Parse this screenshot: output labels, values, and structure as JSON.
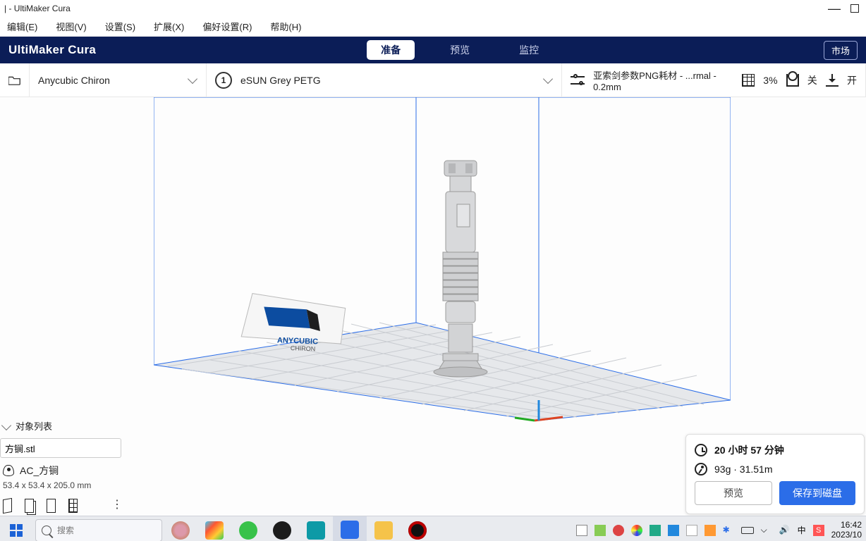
{
  "title": "| - UltiMaker Cura",
  "menu": [
    "编辑(E)",
    "视图(V)",
    "设置(S)",
    "扩展(X)",
    "偏好设置(R)",
    "帮助(H)"
  ],
  "brand": "UltiMaker Cura",
  "tabs": {
    "prepare": "准备",
    "preview": "预览",
    "monitor": "监控"
  },
  "market": "市场",
  "printer": "Anycubic Chiron",
  "extruder_num": "1",
  "material": "eSUN Grey PETG",
  "profile": {
    "name": "亚索剑参数PNG耗材 - ...rmal - 0.2mm",
    "infill": "3%",
    "support": "关",
    "adhesion": "开"
  },
  "object_list": {
    "header": "对象列表",
    "file": "方锏.stl",
    "name": "AC_方锏",
    "dims": "53.4 x 53.4 x 205.0  mm"
  },
  "slice": {
    "time": "20 小时 57 分钟",
    "weight": "93g · 31.51m",
    "preview_btn": "预览",
    "save_btn": "保存到磁盘"
  },
  "bed_label": {
    "line1": "ANYCUBIC",
    "line2": "CHIRON"
  },
  "taskbar": {
    "search": "搜索",
    "clock": "16:42",
    "date": "2023/10"
  }
}
